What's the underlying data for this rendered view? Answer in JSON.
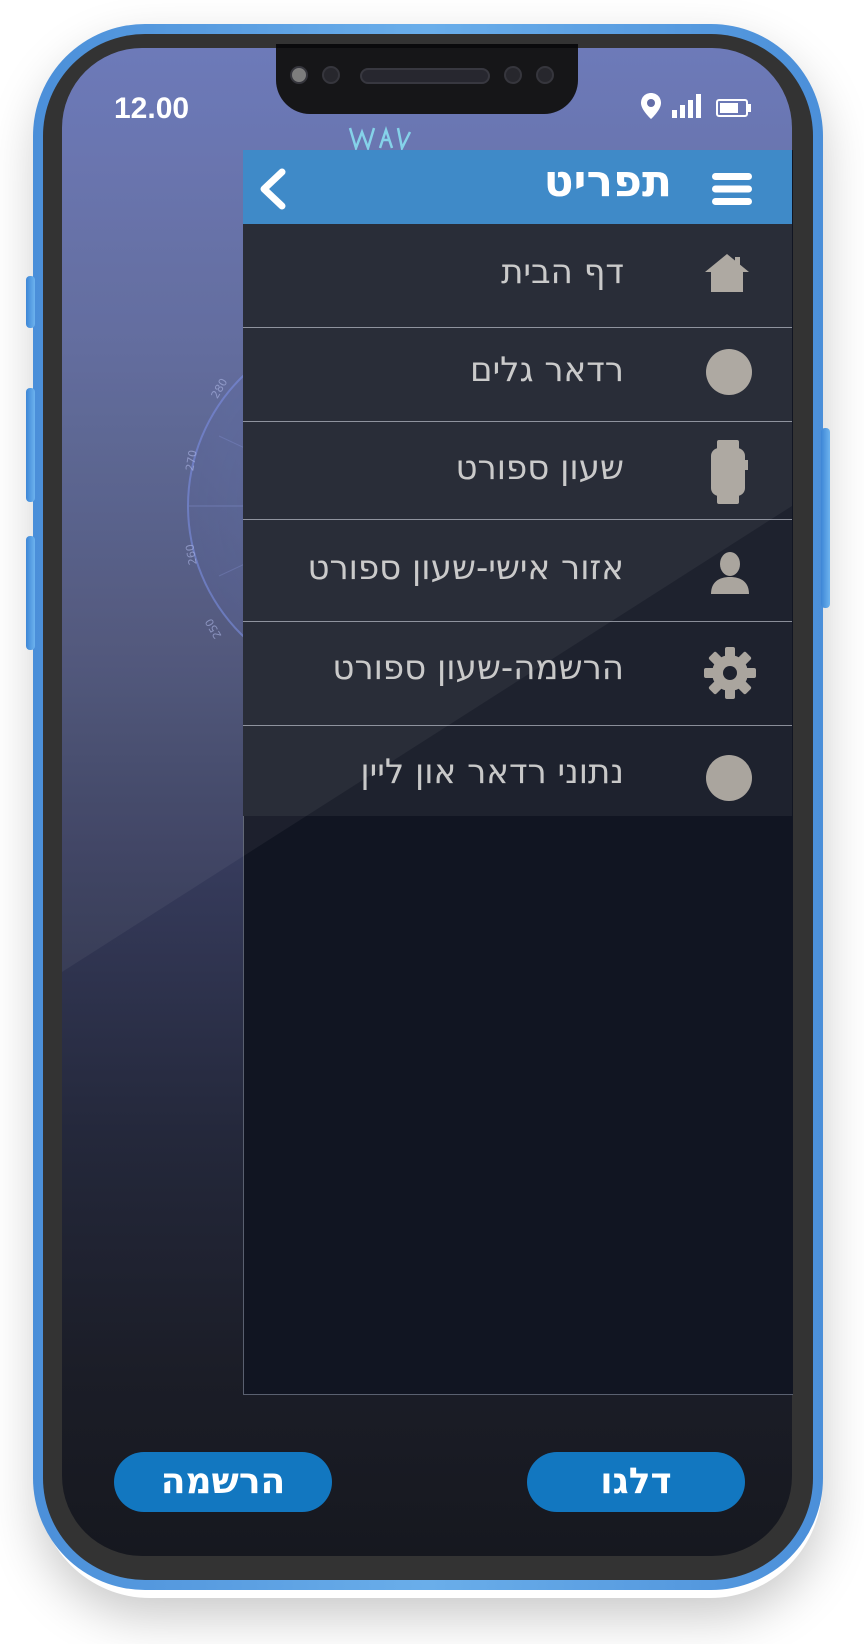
{
  "status_bar": {
    "time": "12.00"
  },
  "menu": {
    "title": "תפריט",
    "items": [
      {
        "label": "דף הבית",
        "icon": "home-icon"
      },
      {
        "label": "רדאר גלים",
        "icon": "circle-icon"
      },
      {
        "label": "שעון ספורט",
        "icon": "watch-icon"
      },
      {
        "label": "אזור אישי-שעון ספורט",
        "icon": "user-icon"
      },
      {
        "label": "הרשמה-שעון ספורט",
        "icon": "gear-icon"
      },
      {
        "label": "נתוני רדאר און ליין",
        "icon": "circle-icon"
      }
    ]
  },
  "buttons": {
    "register": "הרשמה",
    "skip": "דלגו"
  },
  "radar": {
    "ticks": [
      "280",
      "270",
      "260",
      "250"
    ]
  },
  "colors": {
    "accent": "#3584c6",
    "button": "#1277c0",
    "drawer_bg": "#111522",
    "item_bg": "#1e222e",
    "icon_gray": "#aaa59e",
    "frame_blue": "#4b8fd9"
  }
}
